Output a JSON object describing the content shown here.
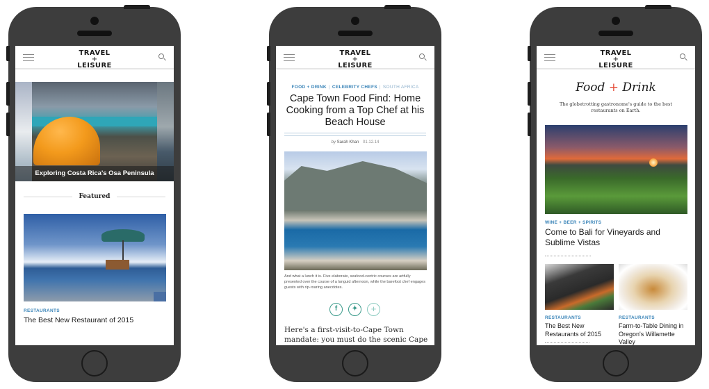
{
  "brand": {
    "logo_line1": "TRAVEL",
    "logo_plus": "+",
    "logo_line2": "LEISURE"
  },
  "colors": {
    "accent_blue": "#3a84b8",
    "share_green": "#3a9a8a",
    "plus_red": "#e44a35",
    "phone_body": "#3d3d3d"
  },
  "icons": {
    "menu": "hamburger-icon",
    "search": "search-icon",
    "facebook": "f",
    "twitter": "✦",
    "more": "+"
  },
  "phone1": {
    "hero_caption": "Exploring Costa Rica's Osa Peninsula",
    "section_heading": "Featured",
    "featured_category": "Restaurants",
    "featured_title": "The Best New Restaurant of 2015"
  },
  "phone2": {
    "categories": [
      "FOOD + DRINK",
      "CELEBRITY CHEFS",
      "SOUTH AFRICA"
    ],
    "separator": "|",
    "title": "Cape Town Food Find: Home Cooking from a Top Chef at his Beach House",
    "byline_prefix": "by",
    "author": "Sarah Khan",
    "date": "01.12.14",
    "image_caption": "And what a lunch it is. Five elaborate, seafood-centric courses are artfully presented over the course of a languid afternoon, while the barefoot chef engages guests with rip-roaring anecdotes.",
    "body": "Here's a first-visit-to-Cape Town mandate: you must do the scenic Cape Point drive. If"
  },
  "phone3": {
    "title_left": "Food",
    "title_plus": "+",
    "title_right": "Drink",
    "subtitle": "The globetrotting gastronome's guide to the best restaurants on Earth.",
    "lead_category": "WINE + BEER + SPIRITS",
    "lead_title": "Come to Bali for Vineyards and Sublime Vistas",
    "cards": [
      {
        "category": "RESTAURANTS",
        "title": "The Best New Restaurants of 2015"
      },
      {
        "category": "RESTAURANTS",
        "title": "Farm-to-Table Dining in Oregon's Willamette Valley"
      }
    ]
  }
}
